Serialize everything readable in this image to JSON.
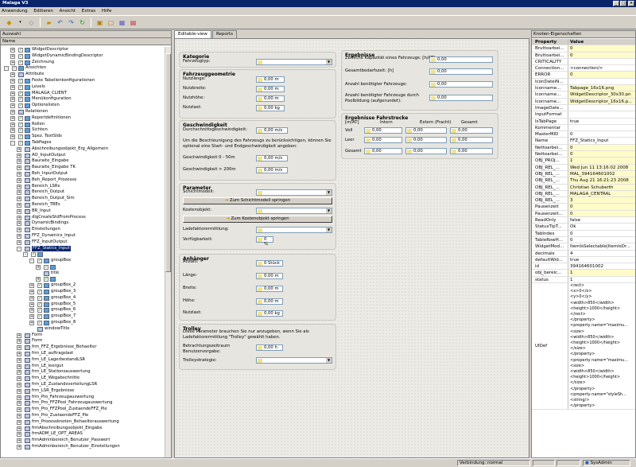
{
  "window": {
    "title": "Malaga V3",
    "controls": [
      "_",
      "□",
      "×"
    ]
  },
  "menu": [
    "Anwendung",
    "Editieren",
    "Ansicht",
    "Extras",
    "Hilfe"
  ],
  "left": {
    "title": "Auswahl",
    "col": "Name",
    "rows": [
      {
        "l": "WidgetDescriptor",
        "d": 3,
        "e": "+",
        "c": 1
      },
      {
        "l": "WidgetDynamicBindingDescriptor",
        "d": 3,
        "e": "+",
        "c": 1
      },
      {
        "l": "Zeichnung",
        "d": 3,
        "e": "+",
        "c": 1
      },
      {
        "l": "Ansichten",
        "d": 2,
        "e": "-",
        "c": 1
      },
      {
        "l": "Attribute",
        "d": 3,
        "e": "+",
        "c": 0
      },
      {
        "l": "Feste Tabellenkonfigurationen",
        "d": 3,
        "e": "+",
        "c": 1
      },
      {
        "l": "Levels",
        "d": 3,
        "e": "+",
        "c": 1
      },
      {
        "l": "MALAGA_CLIENT",
        "d": 3,
        "e": "+",
        "c": 1
      },
      {
        "l": "Menükonfiguration",
        "d": 3,
        "e": "+",
        "c": 1
      },
      {
        "l": "Optionslisten",
        "d": 3,
        "e": "+",
        "c": 1
      },
      {
        "l": "Relationen",
        "d": 3,
        "e": "+",
        "c": 0
      },
      {
        "l": "Reportdefinitionen",
        "d": 3,
        "e": "+",
        "c": 1
      },
      {
        "l": "Rollen",
        "d": 3,
        "e": "+",
        "c": 1
      },
      {
        "l": "Sichten",
        "d": 3,
        "e": "+",
        "c": 1
      },
      {
        "l": "Spez. TextSIds",
        "d": 3,
        "e": "+",
        "c": 1
      },
      {
        "l": "TabPages",
        "d": 3,
        "e": "-",
        "c": 1
      },
      {
        "l": "Abschreibungsobjekt_Erg_Allgemein",
        "d": 4,
        "e": "+",
        "c": 0
      },
      {
        "l": "AO_InputOutput",
        "d": 4,
        "e": "+",
        "c": 0
      },
      {
        "l": "Bauraite_Eingabe",
        "d": 4,
        "e": "+",
        "c": 0
      },
      {
        "l": "Bauraite_Eingabe TK",
        "d": 4,
        "e": "+",
        "c": 0
      },
      {
        "l": "Beh_InputOutput",
        "d": 4,
        "e": "+",
        "c": 0
      },
      {
        "l": "Beh_Report_Prozesse",
        "d": 4,
        "e": "+",
        "c": 0
      },
      {
        "l": "Bereich_LSRs",
        "d": 4,
        "e": "+",
        "c": 0
      },
      {
        "l": "Bereich_Output",
        "d": 4,
        "e": "+",
        "c": 0
      },
      {
        "l": "Bereich_Output_Sim",
        "d": 4,
        "e": "+",
        "c": 0
      },
      {
        "l": "Bereich_TBEs",
        "d": 4,
        "e": "+",
        "c": 0
      },
      {
        "l": "BR_Input",
        "d": 4,
        "e": "+",
        "c": 0
      },
      {
        "l": "dlgCreateStdFromProcess",
        "d": 4,
        "e": "+",
        "c": 0
      },
      {
        "l": "DynamicBindings",
        "d": 4,
        "e": "+",
        "c": 0
      },
      {
        "l": "Einstellungen",
        "d": 4,
        "e": "+",
        "c": 0
      },
      {
        "l": "FFZ_Dynamics_Input",
        "d": 4,
        "e": "+",
        "c": 0
      },
      {
        "l": "FFZ_InputOutput",
        "d": 4,
        "e": "+",
        "c": 0
      },
      {
        "l": "FFZ_Statics_Input",
        "d": 4,
        "e": "-",
        "c": 0,
        "s": 1
      },
      {
        "l": "",
        "d": 5,
        "e": "-",
        "c": 1
      },
      {
        "l": "groupBox",
        "d": 6,
        "e": "-",
        "c": 1
      },
      {
        "l": "",
        "d": 7,
        "e": "+",
        "c": 1
      },
      {
        "l": "title",
        "d": 7,
        "e": "",
        "c": 0
      },
      {
        "l": "",
        "d": 7,
        "e": "+",
        "c": 1
      },
      {
        "l": "groupBox_2",
        "d": 6,
        "e": "+",
        "c": 1
      },
      {
        "l": "groupBox_3",
        "d": 6,
        "e": "+",
        "c": 1
      },
      {
        "l": "groupBox_4",
        "d": 6,
        "e": "+",
        "c": 1
      },
      {
        "l": "groupBox_5",
        "d": 6,
        "e": "+",
        "c": 1
      },
      {
        "l": "groupBox_6",
        "d": 6,
        "e": "+",
        "c": 1
      },
      {
        "l": "groupBox_7",
        "d": 6,
        "e": "+",
        "c": 1
      },
      {
        "l": "groupBox_8",
        "d": 6,
        "e": "+",
        "c": 1
      },
      {
        "l": "windowTitle",
        "d": 6,
        "e": "",
        "c": 0
      },
      {
        "l": "Form",
        "d": 4,
        "e": "+",
        "c": 0
      },
      {
        "l": "Form",
        "d": 4,
        "e": "+",
        "c": 0
      },
      {
        "l": "frm_FFZ_Ergebnisse_Behaelter",
        "d": 4,
        "e": "+",
        "c": 0
      },
      {
        "l": "frm_LE_auftragslast",
        "d": 4,
        "e": "+",
        "c": 0
      },
      {
        "l": "frm_LE_LagerbestandLSR",
        "d": 4,
        "e": "+",
        "c": 0
      },
      {
        "l": "frm_LE_leergut",
        "d": 4,
        "e": "+",
        "c": 0
      },
      {
        "l": "frm_LE_Stationsauswertung",
        "d": 4,
        "e": "+",
        "c": 0
      },
      {
        "l": "frm_LE_Wegabschnitte",
        "d": 4,
        "e": "+",
        "c": 0
      },
      {
        "l": "frm_LE_ZustandsverteilungLSR",
        "d": 4,
        "e": "+",
        "c": 0
      },
      {
        "l": "frm_LSR_Ergebnisse",
        "d": 4,
        "e": "+",
        "c": 0
      },
      {
        "l": "frm_Pro_Fahrzeugauswertung",
        "d": 4,
        "e": "+",
        "c": 0
      },
      {
        "l": "frm_Pro_FFZPool_Fahrzeugauswertung",
        "d": 4,
        "e": "+",
        "c": 0
      },
      {
        "l": "frm_Pro_FFZPool_ZustaendeFFZ_Pie",
        "d": 4,
        "e": "+",
        "c": 0
      },
      {
        "l": "frm_Pro_ZustaendeFFZ_Pie",
        "d": 4,
        "e": "+",
        "c": 0
      },
      {
        "l": "frm_Prozessknoten_Behaelterauswertung",
        "d": 4,
        "e": "+",
        "c": 0
      },
      {
        "l": "frmAbschreibungsobjekt_Eingabe",
        "d": 4,
        "e": "+",
        "c": 0
      },
      {
        "l": "frmADM_LE_OPT_AREAS",
        "d": 4,
        "e": "+",
        "c": 0
      },
      {
        "l": "frmAdminbereich_Benutzer_Passwort",
        "d": 4,
        "e": "+",
        "c": 0
      },
      {
        "l": "frmAdminbereich_Benutzer_Einstellungen",
        "d": 4,
        "e": "+",
        "c": 0
      }
    ]
  },
  "center": {
    "tabs": [
      "Editable-view",
      "Reports"
    ],
    "kategorie": {
      "title": "Kategorie",
      "label": "Fahrzeugtyp:"
    },
    "fahrzeug": {
      "title": "Fahrzeuggeometrie",
      "rows": [
        [
          "Nutzlänge:",
          "0,00 m"
        ],
        [
          "Nutzbreite:",
          "0,00 m"
        ],
        [
          "Nutzhöhe:",
          "0,00 m"
        ],
        [
          "Nutzlast:",
          "0,00 kg"
        ]
      ]
    },
    "geschw": {
      "title": "Geschwindigkeit",
      "label": "Durchschnittsgeschwindigkeit:",
      "value": "0,00 m/s",
      "note": "Um die Beschleunigung des Fahrzeugs zu berücksichtigen, können Sie optional eine Start- und Endgeschwindigkeit angeben:",
      "rows": [
        [
          "Geschwindigkeit 0 - 50m",
          "0,00 m/s"
        ],
        [
          "Geschwindigkeit > 200m",
          "0,00 m/s"
        ]
      ]
    },
    "parameter": {
      "title": "Parameter",
      "schicht": "Schichtmodell:",
      "btn1": "Zum Schichtmodell springen",
      "kosten": "Kostenobjekt:",
      "btn2": "Zum Kostenobjekt springen",
      "lade": "Ladefaktorermittlung:",
      "verf": "Verfügbarkeit:",
      "verf_val": "0 %"
    },
    "anhaenger": {
      "title": "Anhänger",
      "rows": [
        [
          "Anzahl:",
          "0 Stück"
        ],
        [
          "Länge:",
          "0,00 m"
        ],
        [
          "Breite:",
          "0,00 m"
        ],
        [
          "Höhe:",
          "0,00 m"
        ],
        [
          "Nutzlast:",
          "0,00 kg"
        ]
      ]
    },
    "trolley": {
      "title": "Trolley",
      "note": "Diese Parameter brauchen Sie nur anzugeben, wenn Sie als Ladefaktorermittlung \"Trolley\" gewählt haben.",
      "betr": "Betrachtungszeitraum Benutzervorgabe:",
      "betr_val": "0,00 h",
      "strat": "Trolleystrategie:"
    },
    "ergebnisse": {
      "title": "Ergebnisse",
      "rows": [
        [
          "Zeitliche Kapazität eines Fahrzeugs: [h/AT]",
          "0,00"
        ],
        [
          "Gesamtbedarfszeit: [h]",
          "0,00"
        ],
        [
          "Anzahl benötigter Fahrzeuge:",
          "0,00"
        ],
        [
          "Anzahl benötigter Fahrzeuge durch Poolbildung (aufgerundet):",
          "0,00"
        ]
      ]
    },
    "fahrstrecke": {
      "title": "Ergebnisse Fahrstrecke",
      "unit": "[m/AT]",
      "cols": [
        "Intern",
        "Extern (Fracht)",
        "Gesamt"
      ],
      "rows": [
        {
          "l": "Voll",
          "v": [
            "0,00",
            "0,00",
            "0,00"
          ]
        },
        {
          "l": "Leer",
          "v": [
            "0,00",
            "0,00",
            "0,00"
          ]
        },
        {
          "l": "Gesamt",
          "v": [
            "0,00",
            "0,00",
            "0,00"
          ]
        }
      ]
    }
  },
  "right": {
    "title": "Knoten-Eigenschaften",
    "cols": [
      "Property",
      "Value"
    ],
    "rows": [
      [
        "Bruttoarbei...",
        "0",
        1
      ],
      [
        "Bruttoarbei...",
        "0",
        1
      ],
      [
        "CRITICALITY",
        "",
        0
      ],
      [
        "Connection...",
        "<connection/>",
        0
      ],
      [
        "ERROR",
        "0",
        1
      ],
      [
        "IconDateiN...",
        "",
        0
      ],
      [
        "Iconname...",
        "Tabpage_16x16.png",
        1
      ],
      [
        "Iconname...",
        "WidgetDescriptor_30x30.pn",
        1
      ],
      [
        "Iconname...",
        "WidgetDescriptor_16x16.p...",
        1
      ],
      [
        "ImageDate...",
        "",
        0
      ],
      [
        "InputFormat",
        "",
        0
      ],
      [
        "IsTabPage",
        "true",
        0
      ],
      [
        "Kommentar",
        "",
        0
      ],
      [
        "MasterMID",
        "0",
        0
      ],
      [
        "Name",
        "FFZ_Statics_Input",
        0
      ],
      [
        "Nettoarbei...",
        "0",
        1
      ],
      [
        "Nettoarbei...",
        "0",
        1
      ],
      [
        "OBJ_PROJ...",
        "1",
        1
      ],
      [
        "OBJ_REL_...",
        "Wed Jun 11 13:16:02 2008",
        1
      ],
      [
        "OBJ_REL_...",
        "MAL_394164601002",
        1
      ],
      [
        "OBJ_REL_...",
        "Thu Aug 21 16:21:23 2008",
        1
      ],
      [
        "OBJ_REL_...",
        "Christian Schuberth",
        1
      ],
      [
        "OBJ_REL_...",
        "MALAGA_CENTRAL",
        1
      ],
      [
        "OBJ_REL_...",
        "3",
        1
      ],
      [
        "Pausenzeit",
        "0",
        1
      ],
      [
        "Pausenzeit...",
        "0",
        1
      ],
      [
        "ReadOnly",
        "false",
        0
      ],
      [
        "StatusTipT...",
        "Ok",
        0
      ],
      [
        "TabIndex",
        "0",
        0
      ],
      [
        "TableRowH...",
        "0",
        0
      ],
      [
        "WidgetMod...",
        "ItemIsSelectable|ItemIsDr...",
        0
      ],
      [
        "decimals",
        "4",
        0
      ],
      [
        "defaultWid...",
        "true",
        0
      ],
      [
        "id",
        "394164601002",
        0
      ],
      [
        "obj_bereic...",
        "1",
        1
      ],
      [
        "status",
        "1",
        0
      ]
    ],
    "uidef_key": "UIDef",
    "uidef_lines": [
      "<rect>",
      "<x>0</x>",
      "<y>0</y>",
      "<width>850</width>",
      "<height>1000</height>",
      "</rect>",
      "</property>",
      "<property name=\"maximu...",
      "<size>",
      "<width>850</width>",
      "<height>1000</height>",
      "</size>",
      "</property>",
      "<property name=\"maximu...",
      "<size>",
      "<width>850</width>",
      "<height>1000</height>",
      "</size>",
      "</property>",
      "<property name=\"styleSh...",
      "<string/>",
      "</property>"
    ]
  },
  "status": {
    "conn": "Verbindung: normal",
    "user": "SysAdmin"
  }
}
